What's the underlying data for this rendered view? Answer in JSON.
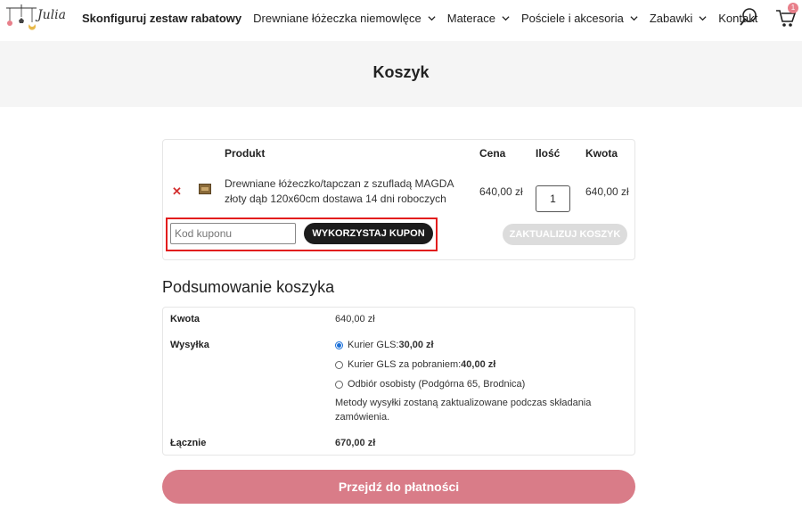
{
  "header": {
    "logo_text": "Julia",
    "nav": [
      {
        "label": "Skonfiguruj zestaw rabatowy",
        "dropdown": false
      },
      {
        "label": "Drewniane łóżeczka niemowlęce",
        "dropdown": true
      },
      {
        "label": "Materace",
        "dropdown": true
      },
      {
        "label": "Pościele i akcesoria",
        "dropdown": true
      },
      {
        "label": "Zabawki",
        "dropdown": true
      },
      {
        "label": "Kontakt",
        "dropdown": false
      }
    ],
    "cart_count": "1",
    "icons": {
      "search": "search-icon",
      "cart": "cart-icon"
    }
  },
  "page_title": "Koszyk",
  "cart": {
    "columns": {
      "product": "Produkt",
      "price": "Cena",
      "qty": "Ilość",
      "amount": "Kwota"
    },
    "items": [
      {
        "name": "Drewniane łóżeczko/tapczan z szufladą MAGDA złoty dąb 120x60cm dostawa 14 dni roboczych",
        "price": "640,00 zł",
        "qty": "1",
        "amount": "640,00 zł"
      }
    ],
    "coupon_placeholder": "Kod kuponu",
    "coupon_button": "WYKORZYSTAJ KUPON",
    "update_button": "ZAKTUALIZUJ KOSZYK"
  },
  "summary": {
    "title": "Podsumowanie koszyka",
    "subtotal_label": "Kwota",
    "subtotal_value": "640,00 zł",
    "shipping_label": "Wysyłka",
    "shipping_options": [
      {
        "label": "Kurier GLS: ",
        "price": "30,00 zł",
        "checked": true
      },
      {
        "label": "Kurier GLS za pobraniem: ",
        "price": "40,00 zł",
        "checked": false
      },
      {
        "label": "Odbiór osobisty (Podgórna 65, Brodnica)",
        "price": "",
        "checked": false
      }
    ],
    "shipping_note": "Metody wysyłki zostaną zaktualizowane podczas składania zamówienia.",
    "total_label": "Łącznie",
    "total_value": "670,00 zł",
    "checkout_button": "Przejdź do płatności"
  },
  "colors": {
    "accent": "#d97c88",
    "remove": "#d32f2f",
    "highlight": "#e21d1d",
    "radio": "#1a6fd8"
  }
}
